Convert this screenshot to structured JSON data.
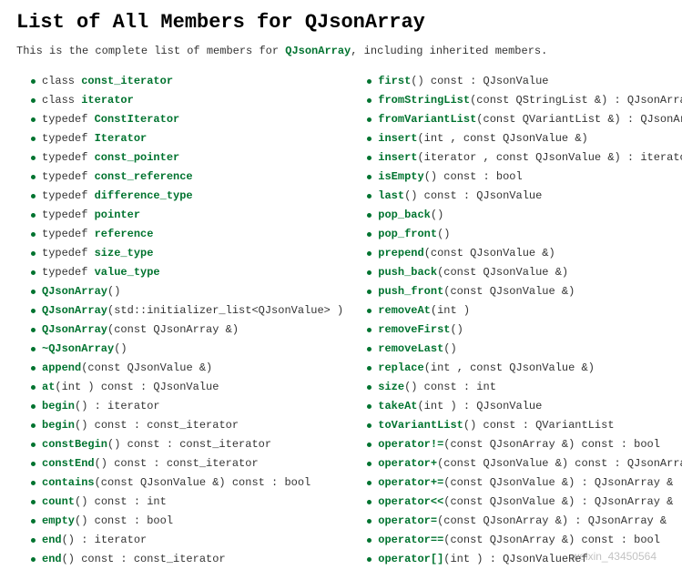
{
  "title": "List of All Members for QJsonArray",
  "intro_prefix": "This is the complete list of members for ",
  "intro_link": "QJsonArray",
  "intro_suffix": ", including inherited members.",
  "watermark": "weixin_43450564",
  "left": [
    {
      "kw": "class ",
      "fn": "const_iterator",
      "sig": ""
    },
    {
      "kw": "class ",
      "fn": "iterator",
      "sig": ""
    },
    {
      "kw": "typedef ",
      "fn": "ConstIterator",
      "sig": ""
    },
    {
      "kw": "typedef ",
      "fn": "Iterator",
      "sig": ""
    },
    {
      "kw": "typedef ",
      "fn": "const_pointer",
      "sig": ""
    },
    {
      "kw": "typedef ",
      "fn": "const_reference",
      "sig": ""
    },
    {
      "kw": "typedef ",
      "fn": "difference_type",
      "sig": ""
    },
    {
      "kw": "typedef ",
      "fn": "pointer",
      "sig": ""
    },
    {
      "kw": "typedef ",
      "fn": "reference",
      "sig": ""
    },
    {
      "kw": "typedef ",
      "fn": "size_type",
      "sig": ""
    },
    {
      "kw": "typedef ",
      "fn": "value_type",
      "sig": ""
    },
    {
      "kw": "",
      "fn": "QJsonArray",
      "sig": "()"
    },
    {
      "kw": "",
      "fn": "QJsonArray",
      "sig": "(std::initializer_list<QJsonValue> )"
    },
    {
      "kw": "",
      "fn": "QJsonArray",
      "sig": "(const QJsonArray &)"
    },
    {
      "kw": "",
      "fn": "~QJsonArray",
      "sig": "()"
    },
    {
      "kw": "",
      "fn": "append",
      "sig": "(const QJsonValue &)"
    },
    {
      "kw": "",
      "fn": "at",
      "sig": "(int ) const : QJsonValue"
    },
    {
      "kw": "",
      "fn": "begin",
      "sig": "() : iterator"
    },
    {
      "kw": "",
      "fn": "begin",
      "sig": "() const : const_iterator"
    },
    {
      "kw": "",
      "fn": "constBegin",
      "sig": "() const : const_iterator"
    },
    {
      "kw": "",
      "fn": "constEnd",
      "sig": "() const : const_iterator"
    },
    {
      "kw": "",
      "fn": "contains",
      "sig": "(const QJsonValue &) const : bool"
    },
    {
      "kw": "",
      "fn": "count",
      "sig": "() const : int"
    },
    {
      "kw": "",
      "fn": "empty",
      "sig": "() const : bool"
    },
    {
      "kw": "",
      "fn": "end",
      "sig": "() : iterator"
    },
    {
      "kw": "",
      "fn": "end",
      "sig": "() const : const_iterator"
    }
  ],
  "right": [
    {
      "kw": "",
      "fn": "first",
      "sig": "() const : QJsonValue"
    },
    {
      "kw": "",
      "fn": "fromStringList",
      "sig": "(const QStringList &) : QJsonArray"
    },
    {
      "kw": "",
      "fn": "fromVariantList",
      "sig": "(const QVariantList &) : QJsonArray"
    },
    {
      "kw": "",
      "fn": "insert",
      "sig": "(int , const QJsonValue &)"
    },
    {
      "kw": "",
      "fn": "insert",
      "sig": "(iterator , const QJsonValue &) : iterator"
    },
    {
      "kw": "",
      "fn": "isEmpty",
      "sig": "() const : bool"
    },
    {
      "kw": "",
      "fn": "last",
      "sig": "() const : QJsonValue"
    },
    {
      "kw": "",
      "fn": "pop_back",
      "sig": "()"
    },
    {
      "kw": "",
      "fn": "pop_front",
      "sig": "()"
    },
    {
      "kw": "",
      "fn": "prepend",
      "sig": "(const QJsonValue &)"
    },
    {
      "kw": "",
      "fn": "push_back",
      "sig": "(const QJsonValue &)"
    },
    {
      "kw": "",
      "fn": "push_front",
      "sig": "(const QJsonValue &)"
    },
    {
      "kw": "",
      "fn": "removeAt",
      "sig": "(int )"
    },
    {
      "kw": "",
      "fn": "removeFirst",
      "sig": "()"
    },
    {
      "kw": "",
      "fn": "removeLast",
      "sig": "()"
    },
    {
      "kw": "",
      "fn": "replace",
      "sig": "(int , const QJsonValue &)"
    },
    {
      "kw": "",
      "fn": "size",
      "sig": "() const : int"
    },
    {
      "kw": "",
      "fn": "takeAt",
      "sig": "(int ) : QJsonValue"
    },
    {
      "kw": "",
      "fn": "toVariantList",
      "sig": "() const : QVariantList"
    },
    {
      "kw": "",
      "fn": "operator!=",
      "sig": "(const QJsonArray &) const : bool"
    },
    {
      "kw": "",
      "fn": "operator+",
      "sig": "(const QJsonValue &) const : QJsonArray"
    },
    {
      "kw": "",
      "fn": "operator+=",
      "sig": "(const QJsonValue &) : QJsonArray &"
    },
    {
      "kw": "",
      "fn": "operator<<",
      "sig": "(const QJsonValue &) : QJsonArray &"
    },
    {
      "kw": "",
      "fn": "operator=",
      "sig": "(const QJsonArray &) : QJsonArray &"
    },
    {
      "kw": "",
      "fn": "operator==",
      "sig": "(const QJsonArray &) const : bool"
    },
    {
      "kw": "",
      "fn": "operator[]",
      "sig": "(int ) : QJsonValueRef"
    }
  ]
}
